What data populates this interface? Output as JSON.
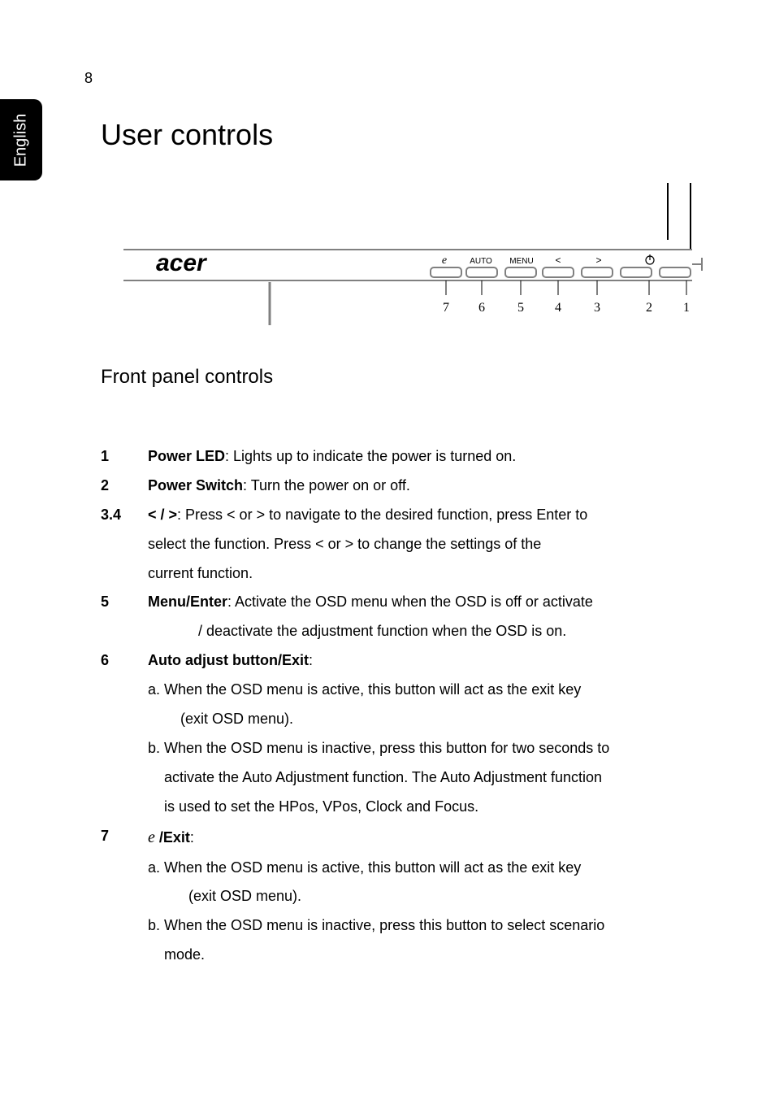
{
  "page_number": "8",
  "lang_tab": "English",
  "heading": "User controls",
  "subheading": "Front panel controls",
  "diagram": {
    "brand": "acer",
    "button_e": "e",
    "button_auto": "AUTO",
    "button_menu": "MENU",
    "button_lt": "<",
    "button_gt": ">",
    "labels": {
      "n1": "1",
      "n2": "2",
      "n3": "3",
      "n4": "4",
      "n5": "5",
      "n6": "6",
      "n7": "7"
    }
  },
  "items": {
    "n1": "1",
    "t1_bold": "Power LED",
    "t1_rest": ": Lights up to indicate the power is turned on.",
    "n2": "2",
    "t2_bold": "Power Switch",
    "t2_rest": ": Turn the power on or off.",
    "n34": "3.4",
    "t34_bold": "< / >",
    "t34_rest1": ": Press < or > to navigate to the desired function, press Enter to",
    "t34_rest2": "select the function. Press < or > to change the settings of the",
    "t34_rest3": "current function.",
    "n5": "5",
    "t5_bold": "Menu/Enter",
    "t5_rest1": ": Activate the OSD menu when the OSD is off or activate",
    "t5_rest2": "/ deactivate the adjustment function when the OSD is on.",
    "n6": "6",
    "t6_bold": "Auto adjust button/Exit",
    "t6_colon": ":",
    "t6_a1": "a. When the OSD menu is active, this button will act as the exit key",
    "t6_a2": "(exit OSD menu).",
    "t6_b1": "b. When the OSD menu is inactive, press this button for two seconds to",
    "t6_b2": "activate the Auto Adjustment function. The Auto Adjustment function",
    "t6_b3": "is used to set the HPos, VPos, Clock and Focus.",
    "n7": "7",
    "t7_e": "e",
    "t7_bold": " /Exit",
    "t7_colon": ":",
    "t7_a1": "a. When the OSD menu is active, this button will act as the exit key",
    "t7_a2": "(exit OSD menu).",
    "t7_b1": "b. When the OSD menu is inactive, press this button to select scenario",
    "t7_b2": "mode."
  }
}
